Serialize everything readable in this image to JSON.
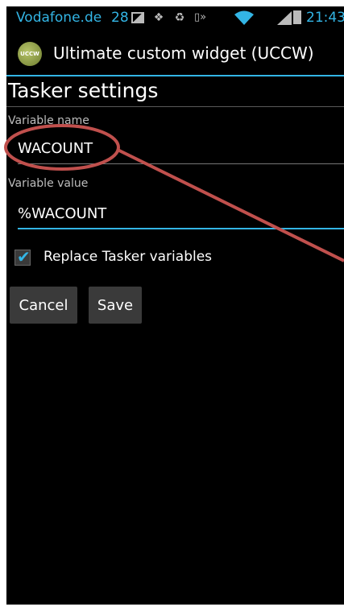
{
  "status_bar": {
    "carrier": "Vodafone.de",
    "notification_count": "28",
    "icons": [
      "gallery-icon",
      "dropbox-icon",
      "recycle-icon",
      "vibrate-icon",
      "wifi-icon",
      "signal-icon",
      "battery-icon"
    ],
    "time": "21:43"
  },
  "title_bar": {
    "logo_text": "UCCW",
    "title": "Ultimate custom widget (UCCW)"
  },
  "content": {
    "heading": "Tasker settings",
    "variable_name": {
      "label": "Variable name",
      "value": "WACOUNT"
    },
    "variable_value": {
      "label": "Variable value",
      "value": "%WACOUNT"
    },
    "replace_checkbox": {
      "label": "Replace Tasker variables",
      "checked": true
    }
  },
  "buttons": {
    "cancel": "Cancel",
    "save": "Save"
  },
  "colors": {
    "accent": "#33b5e5",
    "annotation": "#c0504d",
    "background": "#000000"
  }
}
